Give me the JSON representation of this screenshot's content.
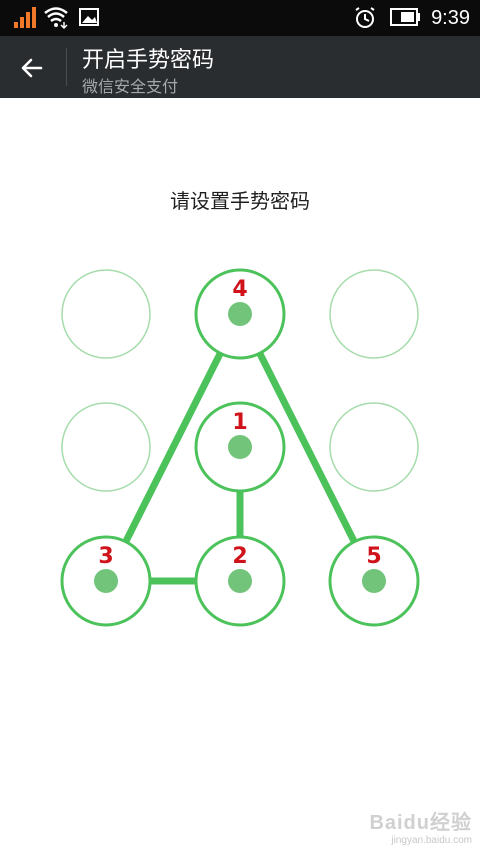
{
  "status_bar": {
    "time": "9:39",
    "icons": [
      "signal-icon",
      "wifi-icon",
      "image-notification-icon",
      "alarm-icon",
      "battery-icon"
    ]
  },
  "header": {
    "title": "开启手势密码",
    "subtitle": "微信安全支付",
    "back_icon": "arrow-left-icon"
  },
  "prompt": "请设置手势密码",
  "pattern": {
    "accent_color": "#4cc25a",
    "number_color": "#d0121b",
    "dots": [
      {
        "row": 1,
        "col": 1,
        "selected": false,
        "order": ""
      },
      {
        "row": 1,
        "col": 2,
        "selected": true,
        "order": "4"
      },
      {
        "row": 1,
        "col": 3,
        "selected": false,
        "order": ""
      },
      {
        "row": 2,
        "col": 1,
        "selected": false,
        "order": ""
      },
      {
        "row": 2,
        "col": 2,
        "selected": true,
        "order": "1"
      },
      {
        "row": 2,
        "col": 3,
        "selected": false,
        "order": ""
      },
      {
        "row": 3,
        "col": 1,
        "selected": true,
        "order": "3"
      },
      {
        "row": 3,
        "col": 2,
        "selected": true,
        "order": "2"
      },
      {
        "row": 3,
        "col": 3,
        "selected": true,
        "order": "5"
      }
    ],
    "path_order": [
      "1",
      "2",
      "3",
      "4",
      "5"
    ]
  },
  "watermark": {
    "logo": "Baidu经验",
    "url": "jingyan.baidu.com"
  }
}
